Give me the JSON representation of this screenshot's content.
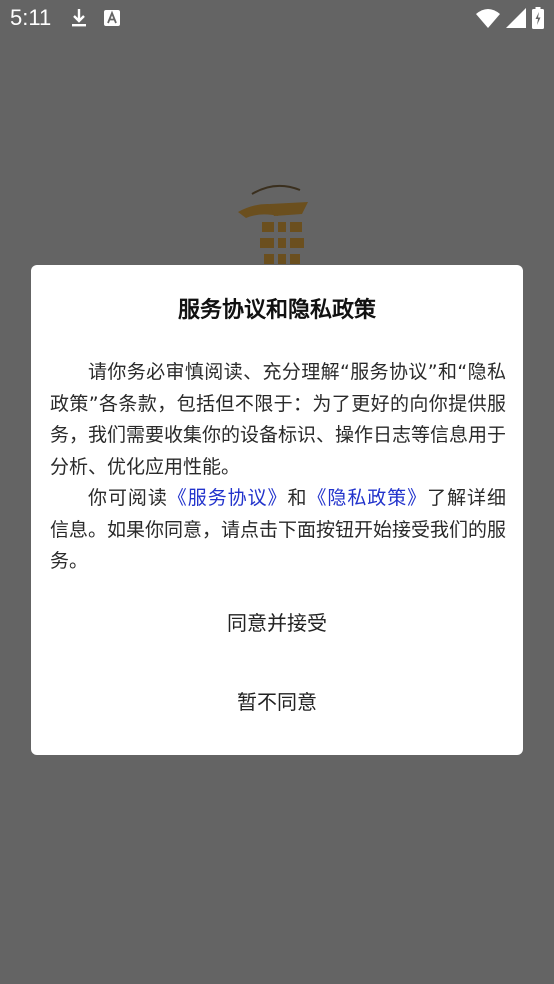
{
  "status_bar": {
    "time": "5:11",
    "icons": [
      "download-icon",
      "text-a-icon",
      "wifi-icon",
      "signal-icon",
      "battery-icon"
    ]
  },
  "splash": {
    "logo_icon": "app-logo",
    "logo_color": "#6b4f1e"
  },
  "dialog": {
    "title": "服务协议和隐私政策",
    "paragraph1": "请你务必审慎阅读、充分理解“服务协议”和“隐私政策”各条款，包括但不限于：为了更好的向你提供服务，我们需要收集你的设备标识、操作日志等信息用于分析、优化应用性能。",
    "p2_prefix": "你可阅读",
    "service_link": "《服务协议》",
    "p2_and": "和",
    "privacy_link": "《隐私政策》",
    "p2_suffix": "了解详细信息。如果你同意，请点击下面按钮开始接受我们的服务。",
    "agree_label": "同意并接受",
    "decline_label": "暂不同意",
    "link_color": "#2233cc"
  }
}
